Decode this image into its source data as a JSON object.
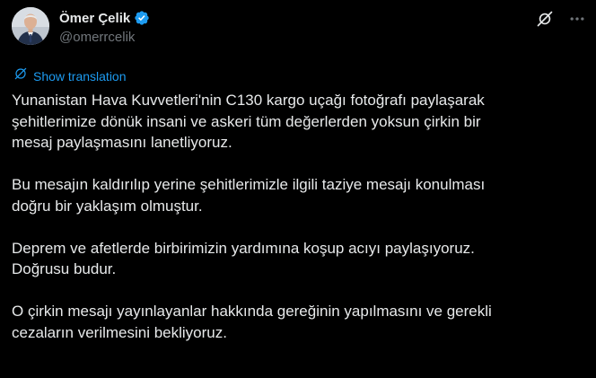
{
  "author": {
    "display_name": "Ömer Çelik",
    "handle": "@omerrcelik",
    "verified": true
  },
  "actions": {
    "grok_icon": "grok-icon",
    "more_icon": "more-dots-icon"
  },
  "translate": {
    "label": "Show translation",
    "icon": "translate-globe-icon"
  },
  "body": {
    "paragraphs": [
      "Yunanistan Hava Kuvvetleri'nin C130 kargo uçağı fotoğrafı paylaşarak\nşehitlerimize dönük insani ve askeri tüm değerlerden yoksun çirkin bir\nmesaj paylaşmasını lanetliyoruz.",
      "Bu mesajın kaldırılıp yerine şehitlerimizle ilgili taziye mesajı konulması\ndoğru bir yaklaşım olmuştur.",
      "Deprem ve afetlerde birbirimizin yardımına koşup acıyı paylaşıyoruz.\nDoğrusu budur.",
      "O çirkin mesajı yayınlayanlar hakkında gereğinin yapılmasını ve gerekli\ncezaların verilmesini bekliyoruz."
    ]
  },
  "colors": {
    "background": "#000000",
    "text": "#e7e9ea",
    "secondary": "#71767b",
    "accent": "#1d9bf0"
  }
}
